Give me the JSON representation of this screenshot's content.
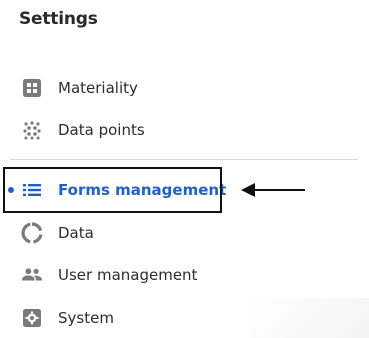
{
  "settings": {
    "title": "Settings",
    "items": [
      {
        "label": "Materiality",
        "icon": "grid-square-icon"
      },
      {
        "label": "Data points",
        "icon": "dot-cluster-icon"
      },
      {
        "label": "Forms management",
        "icon": "list-icon",
        "active": true
      },
      {
        "label": "Data",
        "icon": "ring-chart-icon"
      },
      {
        "label": "User management",
        "icon": "users-icon"
      },
      {
        "label": "System",
        "icon": "gear-box-icon"
      }
    ]
  },
  "colors": {
    "accent": "#1f5fd6",
    "text": "#2d2d2d",
    "icon": "#777777",
    "divider": "#d7d7d7",
    "annotation": "#111111"
  }
}
